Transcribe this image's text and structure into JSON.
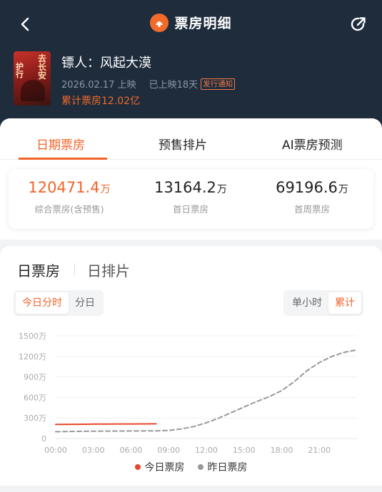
{
  "header": {
    "title": "票房明细",
    "logo_glyph": "●"
  },
  "movie": {
    "name": "镖人：风起大漠",
    "release_date": "2026.02.17 上映",
    "days_showing": "已上映18天",
    "release_notice": "发行通知",
    "total_box_office": "累计票房12.02亿",
    "poster_text_top": "去长安",
    "poster_text_left": "护行"
  },
  "tabs": [
    {
      "label": "日期票房",
      "active": true
    },
    {
      "label": "预售排片",
      "active": false
    },
    {
      "label": "AI票房预测",
      "active": false
    }
  ],
  "stats": [
    {
      "value": "120471.4",
      "unit": "万",
      "label": "综合票房(含预售)",
      "highlight": true
    },
    {
      "value": "13164.2",
      "unit": "万",
      "label": "首日票房",
      "highlight": false
    },
    {
      "value": "69196.6",
      "unit": "万",
      "label": "首周票房",
      "highlight": false
    }
  ],
  "section": {
    "tab_active": "日票房",
    "tab_inactive": "日排片",
    "range_options": [
      "今日分时",
      "分日"
    ],
    "mode_options": [
      "单小时",
      "累计"
    ]
  },
  "chart_data": {
    "type": "line",
    "x_labels": [
      "00:00",
      "03:00",
      "06:00",
      "09:00",
      "12:00",
      "15:00",
      "18:00",
      "21:00"
    ],
    "y_labels": [
      "0",
      "300万",
      "600万",
      "900万",
      "1200万",
      "1500万"
    ],
    "ylim": [
      0,
      1500
    ],
    "xlim": [
      0,
      24
    ],
    "grid": true,
    "series": [
      {
        "name": "今日票房",
        "color": "#e8472b",
        "style": "solid",
        "x": [
          0,
          1,
          2,
          3,
          4,
          5,
          6,
          7,
          8
        ],
        "y": [
          205,
          207,
          208,
          210,
          211,
          212,
          213,
          214,
          215
        ]
      },
      {
        "name": "昨日票房",
        "color": "#999999",
        "style": "dashed",
        "x": [
          0,
          2,
          4,
          6,
          8,
          9,
          10,
          11,
          12,
          13,
          14,
          15,
          16,
          17,
          18,
          19,
          20,
          21,
          22,
          23,
          24
        ],
        "y": [
          100,
          105,
          108,
          110,
          112,
          118,
          140,
          175,
          230,
          300,
          380,
          460,
          540,
          610,
          700,
          830,
          990,
          1110,
          1200,
          1260,
          1295
        ]
      }
    ]
  }
}
